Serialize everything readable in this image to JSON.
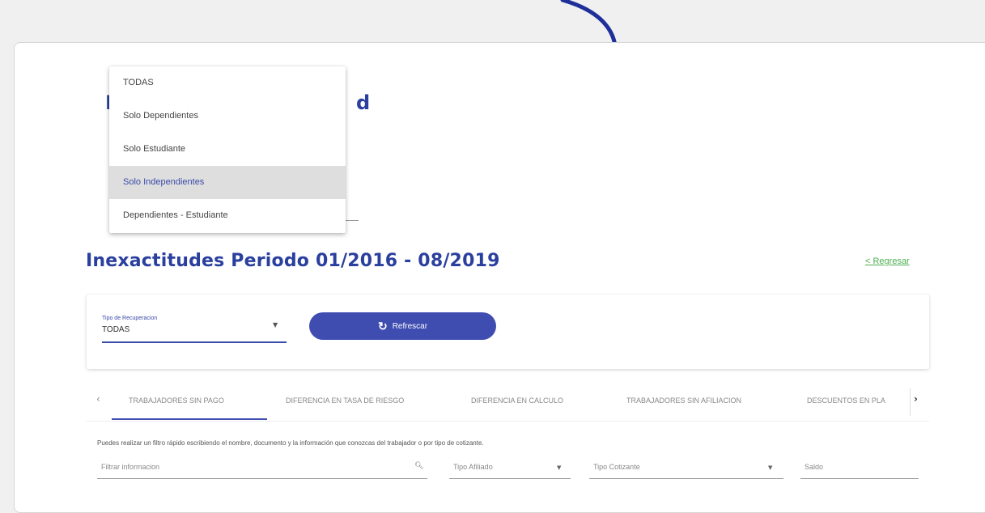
{
  "dropdown": {
    "options": [
      "TODAS",
      "Solo Dependientes",
      "Solo Estudiante",
      "Solo Independientes",
      "Dependientes - Estudiante"
    ],
    "highlighted": "Solo Independientes"
  },
  "header": {
    "title": "Inexactitudes Periodo 01/2016 - 08/2019",
    "back_link": "< Regresar"
  },
  "filter": {
    "select_label": "Tipo de Recuperacion",
    "select_value": "TODAS",
    "refresh_label": "Refrescar"
  },
  "tabs": {
    "items": [
      "TRABAJADORES SIN PAGO",
      "DIFERENCIA EN TASA DE RIESGO",
      "DIFERENCIA EN CALCULO",
      "TRABAJADORES SIN AFILIACION",
      "DESCUENTOS EN PLA"
    ],
    "active": "TRABAJADORES SIN PAGO"
  },
  "table_filters": {
    "help_text": "Puedes realizar un filtro rápido escribiendo el nombre, documento y la información que conozcas del trabajador o por tipo de cotizante.",
    "search_placeholder": "Filtrar informacion",
    "tipo_afiliado": "Tipo Afiliado",
    "tipo_cotizante": "Tipo Cotizante",
    "saldo": "Saldo"
  },
  "colors": {
    "primary": "#3f4db1",
    "title": "#2a3f9e",
    "link": "#4caf50",
    "arrow": "#1e2f9a"
  }
}
